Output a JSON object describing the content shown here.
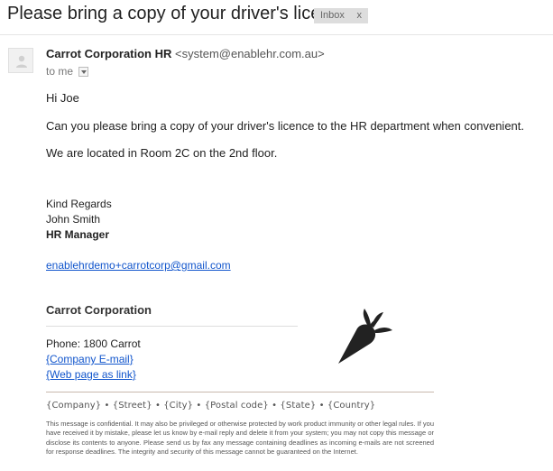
{
  "email": {
    "subject": "Please bring a copy of your driver's licence",
    "label": {
      "name": "Inbox",
      "close": "x"
    },
    "sender": {
      "name": "Carrot Corporation HR",
      "email": "<system@enablehr.com.au>"
    },
    "recipient": "to me",
    "body": [
      "Hi Joe",
      "Can you please bring a copy of your driver's licence to the HR department when convenient.",
      "We are located in Room 2C on the 2nd floor."
    ],
    "signature": {
      "closing": "Kind Regards",
      "name": "John Smith",
      "title": "HR Manager",
      "email_link": "enablehrdemo+carrotcorp@gmail.com",
      "company": "Carrot Corporation",
      "phone": "Phone: 1800 Carrot",
      "company_email_link": "{Company E-mail}",
      "webpage_link": "{Web page as link}",
      "address_placeholders": "{Company} • {Street} • {City} • {Postal code} • {State} • {Country}",
      "disclaimer": "This message is confidential. It may also be privileged or otherwise protected by work product immunity or other legal rules. If you have received it by mistake, please let us know by e-mail reply and delete it from your system; you may not copy this message or disclose its contents to anyone. Please send us by fax any message containing deadlines as incoming e-mails are not screened for response deadlines. The integrity and security of this message cannot be guaranteed on the Internet."
    }
  },
  "icons": {
    "avatar": "person-icon",
    "dropdown": "chevron-down-icon",
    "logo": "carrot-icon"
  },
  "colors": {
    "link": "#1155cc",
    "label_bg": "#dddddd",
    "carrot": "#222222"
  }
}
